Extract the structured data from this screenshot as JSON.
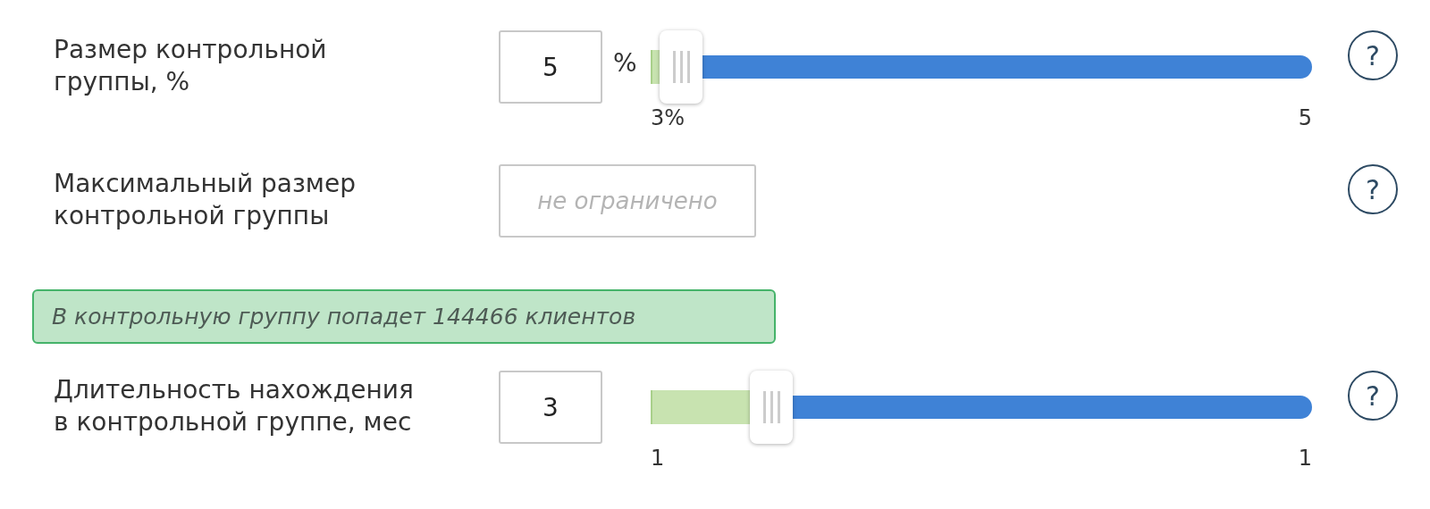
{
  "rows": [
    {
      "kind": "slider",
      "label": "Размер контрольной группы, %",
      "value": "5",
      "unit": "%",
      "level": 0.014,
      "min_label": "3%",
      "max_label": "5",
      "help": "?"
    },
    {
      "kind": "field",
      "label": "Максимальный размер контрольной группы",
      "placeholder": "не ограничено",
      "help": "?"
    },
    {
      "kind": "note",
      "text": "В контрольную группу попадет 144466 клиентов"
    },
    {
      "kind": "slider",
      "label": "Длительность нахождения в контрольной группе, мес",
      "value": "3",
      "level": 0.15,
      "min_label": "1",
      "max_label": "1",
      "help": "?"
    }
  ]
}
